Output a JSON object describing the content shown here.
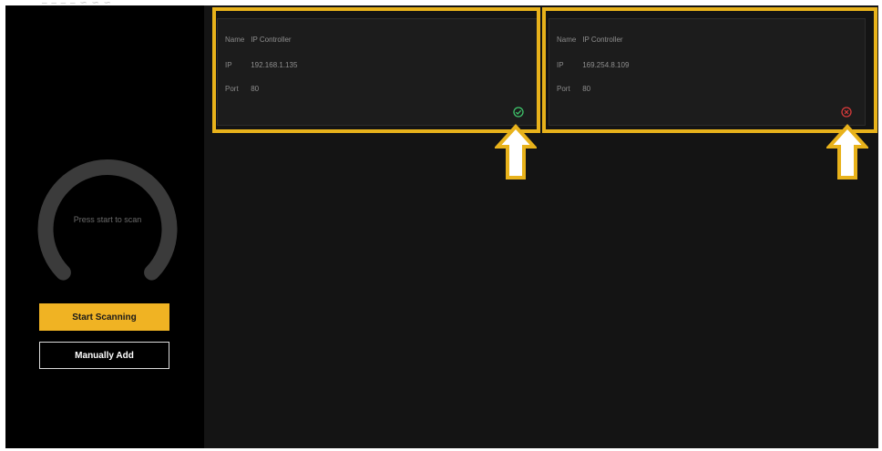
{
  "sidebar": {
    "top_label": "– – – –  ∽ ∽ ∽",
    "scan_prompt": "Press start to scan",
    "start_button_label": "Start Scanning",
    "manual_add_label": "Manually Add"
  },
  "devices": [
    {
      "name_label": "Name",
      "name": "IP Controller",
      "ip_label": "IP",
      "ip": "192.168.1.135",
      "port_label": "Port",
      "port": "80",
      "status": "connected",
      "status_icon": "check-circle-icon"
    },
    {
      "name_label": "Name",
      "name": "IP Controller",
      "ip_label": "IP",
      "ip": "169.254.8.109",
      "port_label": "Port",
      "port": "80",
      "status": "not-connected",
      "status_icon": "cross-circle-icon"
    }
  ],
  "colors": {
    "accent": "#f0b323",
    "highlight": "#e8b21b",
    "ok": "#3fc46b",
    "error": "#d83a3a",
    "background": "#141414"
  }
}
